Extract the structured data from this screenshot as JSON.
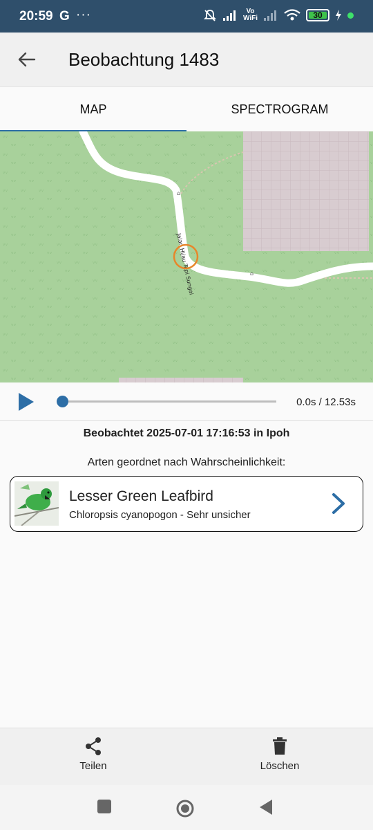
{
  "status": {
    "time": "20:59",
    "g_icon": "G",
    "more": "···",
    "vo": "Vo",
    "wifi_label": "WiFi",
    "battery": "30",
    "icons": [
      "mute-icon",
      "signal-icon",
      "wifi-icon",
      "battery-icon",
      "charging-icon"
    ]
  },
  "appbar": {
    "title": "Beobachtung 1483"
  },
  "tabs": [
    {
      "label": "MAP",
      "active": true
    },
    {
      "label": "SPECTROGRAM",
      "active": false
    }
  ],
  "map": {
    "road_label": "Jalan Hijau Tepi Sungai"
  },
  "player": {
    "time": "0.0s / 12.53s",
    "progress": 0.0
  },
  "observation": {
    "observed": "Beobachtet 2025-07-01 17:16:53 in Ipoh",
    "sorted_label": "Arten geordnet nach Wahrscheinlichkeit:"
  },
  "species": [
    {
      "common_name": "Lesser Green Leafbird",
      "detail": "Chloropsis cyanopogon - Sehr unsicher"
    }
  ],
  "bottom": {
    "share": "Teilen",
    "delete": "Löschen"
  },
  "colors": {
    "accent": "#2d6ea6",
    "statusbar": "#2f4f6b",
    "map_green": "#a8d19b",
    "location_ring": "#e8862a"
  }
}
